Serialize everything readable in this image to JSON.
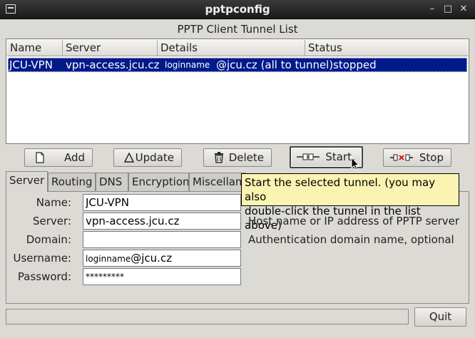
{
  "window": {
    "title": "pptpconfig",
    "controls": {
      "minimize": "–",
      "maximize": "□",
      "close": "✕"
    }
  },
  "list": {
    "title": "PPTP Client Tunnel List",
    "columns": [
      "Name",
      "Server",
      "Details",
      "Status"
    ],
    "rows": [
      {
        "name": "JCU-VPN",
        "server": "vpn-access.jcu.cz",
        "details_user": "loginname",
        "details_rest": "@jcu.cz (all to tunnel)",
        "status": "stopped",
        "selected": true
      }
    ]
  },
  "buttons": {
    "add": {
      "label": "Add",
      "icon": "new-document-icon"
    },
    "update": {
      "label": "Update",
      "icon": "triangle-icon"
    },
    "delete": {
      "label": "Delete",
      "icon": "trash-icon"
    },
    "start": {
      "label": "Start",
      "icon": "plug-connect-icon"
    },
    "stop": {
      "label": "Stop",
      "icon": "plug-disconnect-icon"
    }
  },
  "tabs": [
    "Server",
    "Routing",
    "DNS",
    "Encryption",
    "Miscellane"
  ],
  "active_tab": "Server",
  "tooltip": {
    "line1": "Start the selected tunnel.  (you may also",
    "line2": "double-click the tunnel in the list above)"
  },
  "form": {
    "name": {
      "label": "Name:",
      "value": "JCU-VPN"
    },
    "server": {
      "label": "Server:",
      "value": "vpn-access.jcu.cz",
      "hint": "Host name or IP address of PPTP server"
    },
    "domain": {
      "label": "Domain:",
      "value": "",
      "hint": "Authentication domain name, optional"
    },
    "username": {
      "label": "Username:",
      "value_user": "loginname",
      "value_rest": "@jcu.cz"
    },
    "password": {
      "label": "Password:",
      "value": "*********"
    }
  },
  "footer": {
    "status_text": "",
    "quit_label": "Quit"
  },
  "colors": {
    "selection": "#001a8a",
    "tooltip_bg": "#fbf3b2",
    "window_bg": "#dcdad5"
  }
}
